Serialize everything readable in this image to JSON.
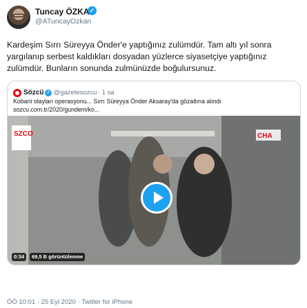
{
  "author": {
    "display_name": "Tuncay ÖZKAN",
    "handle": "@ATuncayOzkan",
    "verified_glyph": "✓"
  },
  "tweet": {
    "text": "Kardeşim Sırrı Süreyya Önder'e yaptığınız zulümdür. Tam altı yıl sonra yargılanıp serbest kaldıkları dosyadan yüzlerce siyasetçiye yaptığınız zulümdür. Bunların sonunda zulmünüzde boğulursunuz."
  },
  "quoted": {
    "name": "Sözcü",
    "verified_glyph": "✓",
    "handle": "@gazetesozcu",
    "separator": "·",
    "time": "1 sa",
    "text_line1": "Kobani olayları operasyonu... Sırrı Süreyya Önder Aksaray'da gözaltına alındı",
    "text_line2": "sozcu.com.tr/2020/gundem/ko...",
    "video": {
      "duration": "0:34",
      "views": "69,5 B görüntülenme",
      "watermark_left": "SZCO",
      "watermark_right": "CHA",
      "icon": "play-icon"
    }
  },
  "meta": {
    "text": "ÖÖ 10:01 · 25 Eyl 2020 · Twitter for iPhone"
  },
  "colors": {
    "accent": "#1da1f2",
    "text": "#14171a",
    "secondary": "#657786",
    "border": "#ccd6dd",
    "sozcu_red": "#e30613"
  }
}
